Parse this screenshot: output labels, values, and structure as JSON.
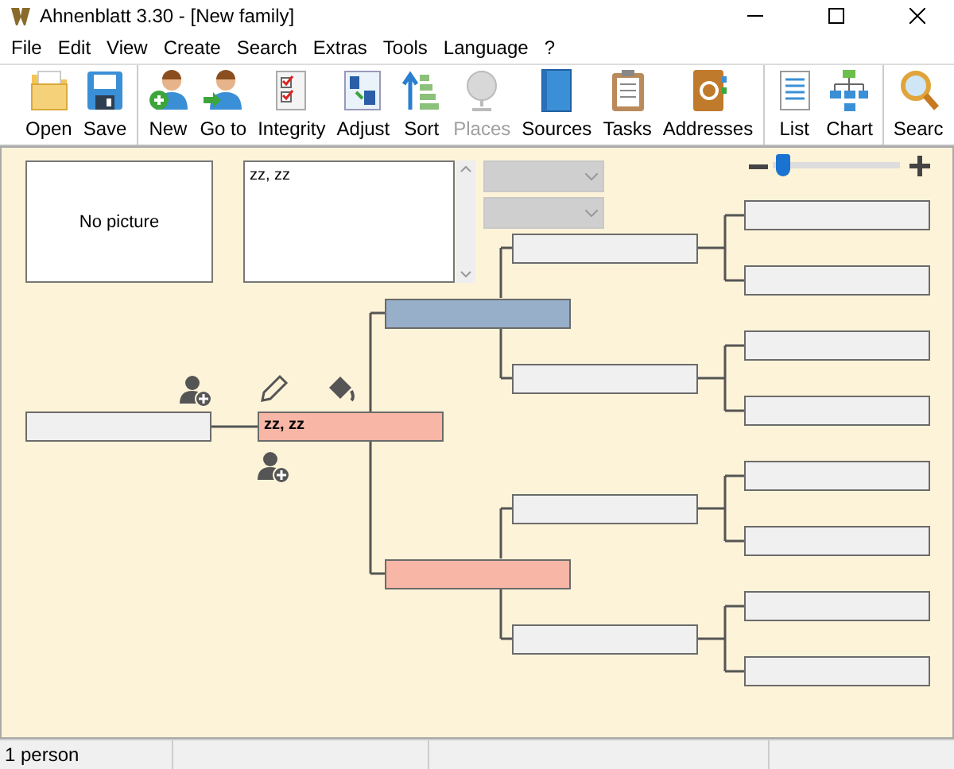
{
  "window": {
    "title": "Ahnenblatt 3.30 - [New family]"
  },
  "menu": [
    {
      "label": "File"
    },
    {
      "label": "Edit"
    },
    {
      "label": "View"
    },
    {
      "label": "Create"
    },
    {
      "label": "Search"
    },
    {
      "label": "Extras"
    },
    {
      "label": "Tools"
    },
    {
      "label": "Language"
    },
    {
      "label": "?"
    }
  ],
  "toolbar": {
    "groups": [
      [
        {
          "label": "Open",
          "disabled": false
        },
        {
          "label": "Save",
          "disabled": false
        }
      ],
      [
        {
          "label": "New",
          "disabled": false
        },
        {
          "label": "Go to",
          "disabled": false
        },
        {
          "label": "Integrity",
          "disabled": false
        },
        {
          "label": "Adjust",
          "disabled": false
        },
        {
          "label": "Sort",
          "disabled": false
        },
        {
          "label": "Places",
          "disabled": true
        },
        {
          "label": "Sources",
          "disabled": false
        },
        {
          "label": "Tasks",
          "disabled": false
        },
        {
          "label": "Addresses",
          "disabled": false
        }
      ],
      [
        {
          "label": "List",
          "disabled": false
        },
        {
          "label": "Chart",
          "disabled": false
        }
      ],
      [
        {
          "label": "Searc",
          "disabled": false
        }
      ]
    ]
  },
  "photo_panel": {
    "text": "No picture"
  },
  "name_list": {
    "items": [
      "zz, zz"
    ]
  },
  "dropdowns": [
    {
      "disabled": true
    },
    {
      "disabled": true
    }
  ],
  "zoom": {
    "level": 0.07
  },
  "pedigree": {
    "spouse": {
      "color": "#f0f0f0"
    },
    "root": {
      "name": "zz, zz",
      "color": "#f7b6a6"
    },
    "parents": [
      {
        "color": "#97afc9"
      },
      {
        "color": "#f7b6a6"
      }
    ],
    "grandparents": [
      {
        "color": "#f0f0f0"
      },
      {
        "color": "#f0f0f0"
      },
      {
        "color": "#f0f0f0"
      },
      {
        "color": "#f0f0f0"
      }
    ],
    "great_grandparents": [
      {
        "color": "#f0f0f0"
      },
      {
        "color": "#f0f0f0"
      },
      {
        "color": "#f0f0f0"
      },
      {
        "color": "#f0f0f0"
      },
      {
        "color": "#f0f0f0"
      },
      {
        "color": "#f0f0f0"
      },
      {
        "color": "#f0f0f0"
      },
      {
        "color": "#f0f0f0"
      }
    ]
  },
  "status_bar": [
    "1 person"
  ]
}
